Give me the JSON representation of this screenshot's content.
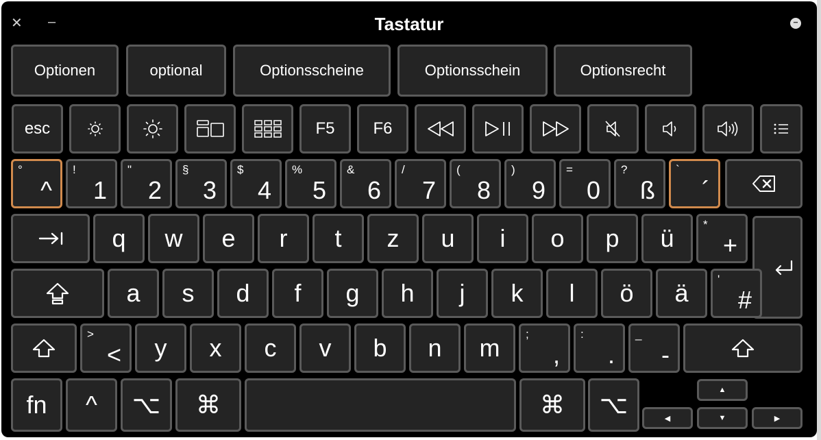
{
  "window": {
    "title": "Tastatur",
    "close_symbol": "✕",
    "minimize_symbol": "–",
    "more_symbol": "•••"
  },
  "suggestions": [
    "Optionen",
    "optional",
    "Optionsscheine",
    "Optionsschein",
    "Optionsrecht"
  ],
  "keys": {
    "esc": "esc",
    "f5": "F5",
    "f6": "F6",
    "fn": "fn",
    "up_caret": "^",
    "alt_symbol": "⌥",
    "cmd_symbol": "⌘",
    "arrow_up": "▲",
    "arrow_down": "▼",
    "arrow_left": "◀",
    "arrow_right": "▶"
  },
  "number_row": [
    {
      "s": "°",
      "p": "^"
    },
    {
      "s": "!",
      "p": "1"
    },
    {
      "s": "\"",
      "p": "2"
    },
    {
      "s": "§",
      "p": "3"
    },
    {
      "s": "$",
      "p": "4"
    },
    {
      "s": "%",
      "p": "5"
    },
    {
      "s": "&",
      "p": "6"
    },
    {
      "s": "/",
      "p": "7"
    },
    {
      "s": "(",
      "p": "8"
    },
    {
      "s": ")",
      "p": "9"
    },
    {
      "s": "=",
      "p": "0"
    },
    {
      "s": "?",
      "p": "ß"
    },
    {
      "s": "`",
      "p": "´"
    }
  ],
  "row_q": [
    "q",
    "w",
    "e",
    "r",
    "t",
    "z",
    "u",
    "i",
    "o",
    "p",
    "ü"
  ],
  "plus_key": {
    "s": "*",
    "p": "+"
  },
  "row_a": [
    "a",
    "s",
    "d",
    "f",
    "g",
    "h",
    "j",
    "k",
    "l",
    "ö",
    "ä"
  ],
  "hash_key": {
    "s": "'",
    "p": "#"
  },
  "angle_key": {
    "s": ">",
    "p": "<"
  },
  "row_y": [
    "y",
    "x",
    "c",
    "v",
    "b",
    "n",
    "m"
  ],
  "punct_keys": [
    {
      "s": ";",
      "p": ","
    },
    {
      "s": ":",
      "p": "."
    },
    {
      "s": "_",
      "p": "-"
    }
  ],
  "colors": {
    "background": "#000000",
    "key": "#242424",
    "key_border": "#5a5a5a",
    "dead_key_highlight": "#d08a4d"
  }
}
